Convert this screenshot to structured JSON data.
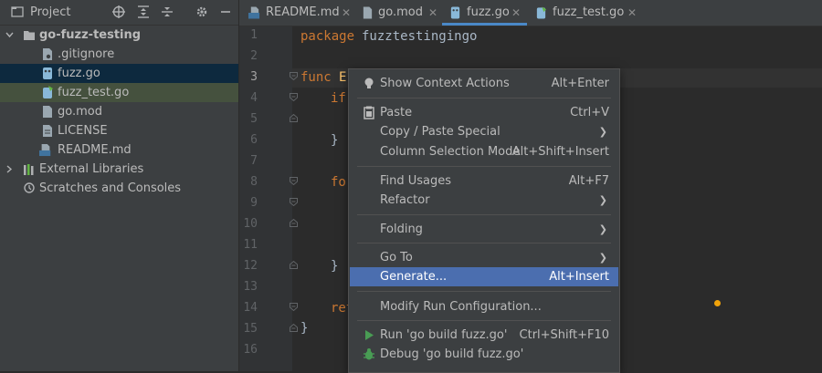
{
  "project_panel": {
    "title": "Project",
    "tree": [
      {
        "label": "go-fuzz-testing",
        "kind": "folder-root"
      },
      {
        "label": ".gitignore",
        "kind": "file"
      },
      {
        "label": "fuzz.go",
        "kind": "go-file",
        "selected": true
      },
      {
        "label": "fuzz_test.go",
        "kind": "go-test-file"
      },
      {
        "label": "go.mod",
        "kind": "file"
      },
      {
        "label": "LICENSE",
        "kind": "file"
      },
      {
        "label": "README.md",
        "kind": "markdown-file"
      },
      {
        "label": "External Libraries",
        "kind": "library"
      },
      {
        "label": "Scratches and Consoles",
        "kind": "scratches"
      }
    ]
  },
  "tabs": [
    {
      "label": "README.md"
    },
    {
      "label": "go.mod"
    },
    {
      "label": "fuzz.go",
      "active": true
    },
    {
      "label": "fuzz_test.go"
    }
  ],
  "editor": {
    "line_numbers": [
      "1",
      "2",
      "3",
      "4",
      "5",
      "6",
      "7",
      "8",
      "9",
      "10",
      "11",
      "12",
      "13",
      "14",
      "15",
      "16"
    ],
    "line1_kw": "package",
    "line1_name": "fuzztestingingo",
    "line3_kw": "func",
    "line3_rest": "E",
    "line4": "if",
    "line6": "}",
    "line8": "for",
    "line12": "}",
    "line14": "ret",
    "line15": "}"
  },
  "context_menu": {
    "items": [
      {
        "label": "Show Context Actions",
        "shortcut": "Alt+Enter",
        "icon": "lightbulb-icon"
      },
      {
        "label": "Paste",
        "shortcut": "Ctrl+V",
        "icon": "clipboard-icon"
      },
      {
        "label": "Copy / Paste Special",
        "submenu": true
      },
      {
        "label": "Column Selection Mode",
        "shortcut": "Alt+Shift+Insert"
      },
      {
        "label": "Find Usages",
        "shortcut": "Alt+F7"
      },
      {
        "label": "Refactor",
        "submenu": true
      },
      {
        "label": "Folding",
        "submenu": true
      },
      {
        "label": "Go To",
        "submenu": true
      },
      {
        "label": "Generate...",
        "shortcut": "Alt+Insert",
        "selected": true
      },
      {
        "label": "Modify Run Configuration..."
      },
      {
        "label": "Run 'go build fuzz.go'",
        "shortcut": "Ctrl+Shift+F10",
        "icon": "run-icon"
      },
      {
        "label": "Debug 'go build fuzz.go'",
        "icon": "debug-icon"
      }
    ]
  },
  "colors": {
    "selection": "#4b6eaf",
    "keyword": "#cc7832",
    "run_green": "#499c54"
  }
}
